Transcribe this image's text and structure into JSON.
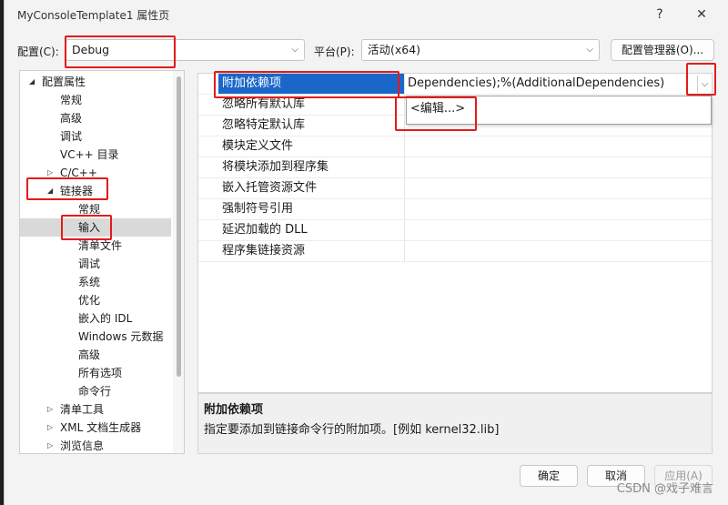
{
  "window": {
    "title": "MyConsoleTemplate1 属性页",
    "help_glyph": "?",
    "close_glyph": "✕"
  },
  "config_bar": {
    "config_label": "配置(C):",
    "config_value": "Debug",
    "platform_label": "平台(P):",
    "platform_value": "活动(x64)",
    "manager_button": "配置管理器(O)..."
  },
  "tree": {
    "items": [
      {
        "label": "配置属性",
        "arrow": "◢"
      },
      {
        "label": "常规",
        "arrow": ""
      },
      {
        "label": "高级",
        "arrow": ""
      },
      {
        "label": "调试",
        "arrow": ""
      },
      {
        "label": "VC++ 目录",
        "arrow": ""
      },
      {
        "label": "C/C++",
        "arrow": "▷"
      },
      {
        "label": "链接器",
        "arrow": "◢"
      },
      {
        "label": "常规",
        "arrow": ""
      },
      {
        "label": "输入",
        "arrow": ""
      },
      {
        "label": "清单文件",
        "arrow": ""
      },
      {
        "label": "调试",
        "arrow": ""
      },
      {
        "label": "系统",
        "arrow": ""
      },
      {
        "label": "优化",
        "arrow": ""
      },
      {
        "label": "嵌入的 IDL",
        "arrow": ""
      },
      {
        "label": "Windows 元数据",
        "arrow": ""
      },
      {
        "label": "高级",
        "arrow": ""
      },
      {
        "label": "所有选项",
        "arrow": ""
      },
      {
        "label": "命令行",
        "arrow": ""
      },
      {
        "label": "清单工具",
        "arrow": "▷"
      },
      {
        "label": "XML 文档生成器",
        "arrow": "▷"
      },
      {
        "label": "浏览信息",
        "arrow": "▷"
      }
    ]
  },
  "grid": {
    "rows": [
      {
        "name": "附加依赖项",
        "value": "Dependencies);%(AdditionalDependencies)"
      },
      {
        "name": "忽略所有默认库",
        "value": ""
      },
      {
        "name": "忽略特定默认库",
        "value": ""
      },
      {
        "name": "模块定义文件",
        "value": ""
      },
      {
        "name": "将模块添加到程序集",
        "value": ""
      },
      {
        "name": "嵌入托管资源文件",
        "value": ""
      },
      {
        "name": "强制符号引用",
        "value": ""
      },
      {
        "name": "延迟加载的 DLL",
        "value": ""
      },
      {
        "name": "程序集链接资源",
        "value": ""
      }
    ],
    "dropdown_item": "<编辑...>"
  },
  "description": {
    "title": "附加依赖项",
    "body": "指定要添加到链接命令行的附加项。[例如 kernel32.lib]"
  },
  "buttons": {
    "ok": "确定",
    "cancel": "取消",
    "apply": "应用(A)"
  },
  "watermark": "CSDN @戏子难言",
  "colors": {
    "selection": "#1b67c9",
    "highlight_box": "#e31b1b"
  }
}
